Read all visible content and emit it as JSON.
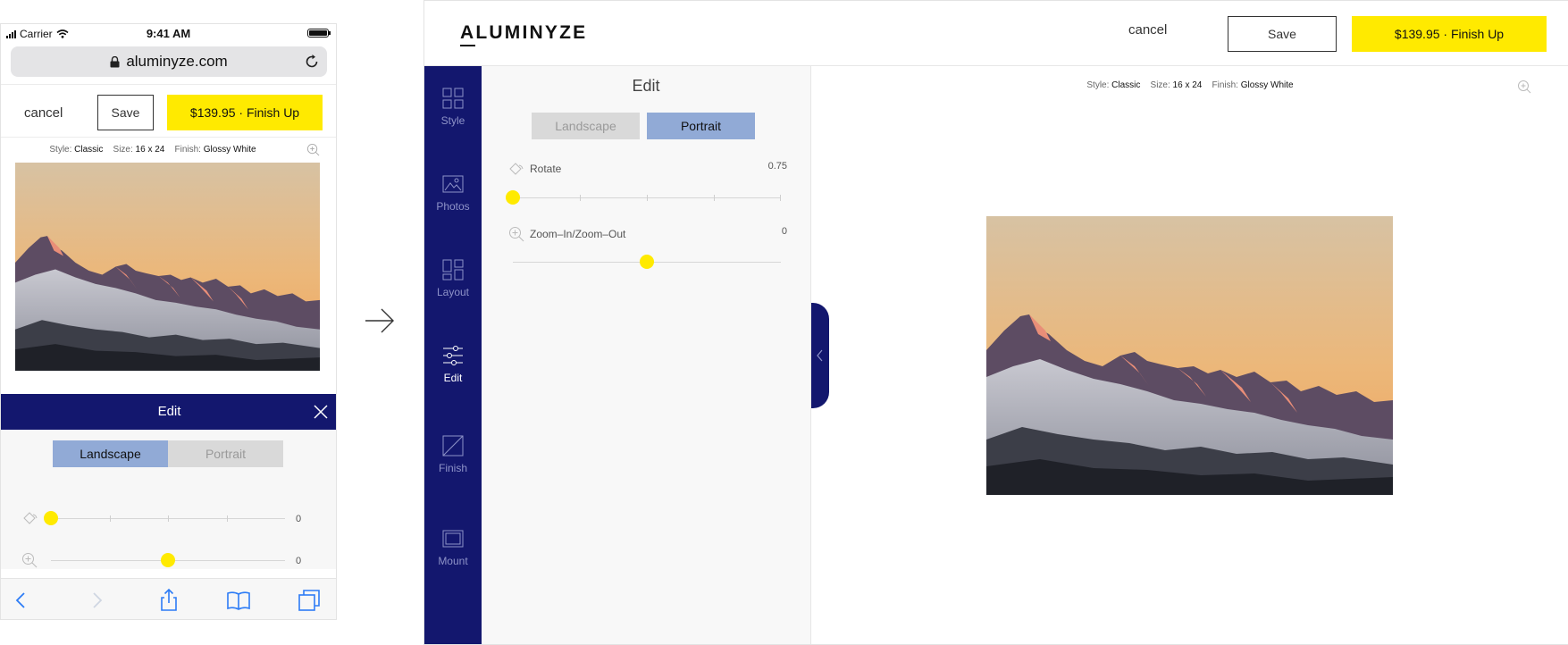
{
  "mobile": {
    "status": {
      "carrier": "Carrier",
      "time": "9:41 AM"
    },
    "url": "aluminyze.com",
    "cancel_label": "cancel",
    "save_label": "Save",
    "finish_label": "$139.95 · Finish Up",
    "meta": {
      "style_label": "Style:",
      "style_value": "Classic",
      "size_label": "Size:",
      "size_value": "16 x 24",
      "finish_label": "Finish:",
      "finish_value": "Glossy White"
    },
    "edit_title": "Edit",
    "orientation": {
      "landscape": "Landscape",
      "portrait": "Portrait",
      "selected": "Landscape"
    },
    "rotate": {
      "value": "0",
      "position": 0
    },
    "zoom": {
      "value": "0",
      "position": 0.5
    }
  },
  "desktop": {
    "logo": "ALUMINYZE",
    "cancel_label": "cancel",
    "save_label": "Save",
    "finish_label": "$139.95 · Finish Up",
    "sidebar": {
      "items": [
        {
          "label": "Style",
          "icon": "grid-icon"
        },
        {
          "label": "Photos",
          "icon": "image-icon"
        },
        {
          "label": "Layout",
          "icon": "layout-icon"
        },
        {
          "label": "Edit",
          "icon": "sliders-icon",
          "active": true
        },
        {
          "label": "Finish",
          "icon": "finish-icon"
        },
        {
          "label": "Mount",
          "icon": "mount-icon"
        }
      ]
    },
    "panel": {
      "title": "Edit",
      "orientation": {
        "landscape": "Landscape",
        "portrait": "Portrait",
        "selected": "Portrait"
      },
      "rotate": {
        "label": "Rotate",
        "value": "0.75",
        "position": 0
      },
      "zoom": {
        "label": "Zoom–In/Zoom–Out",
        "value": "0",
        "position": 0.5
      }
    },
    "meta": {
      "style_label": "Style:",
      "style_value": "Classic",
      "size_label": "Size:",
      "size_value": "16 x 24",
      "finish_label": "Finish:",
      "finish_value": "Glossy White"
    }
  },
  "colors": {
    "accent_yellow": "#ffea00",
    "navy": "#13176e",
    "selected_blue": "#91aad6"
  }
}
